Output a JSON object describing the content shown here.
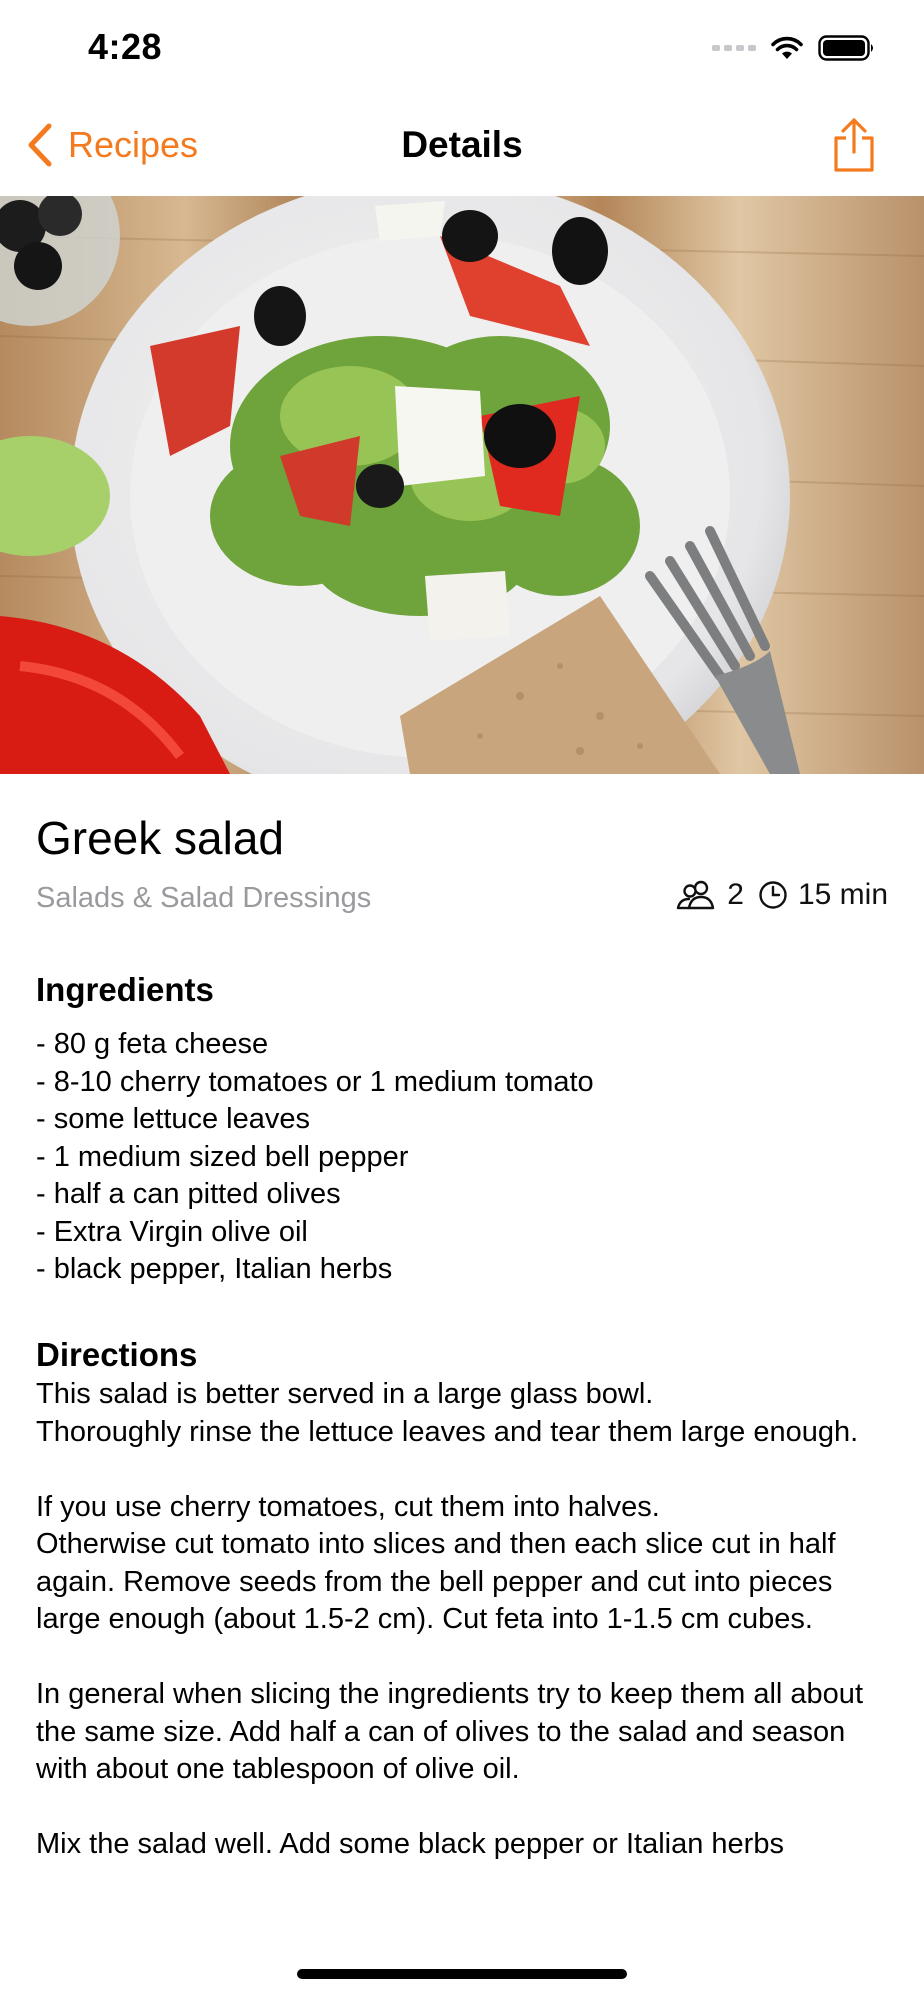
{
  "status_bar": {
    "time": "4:28"
  },
  "nav": {
    "back_label": "Recipes",
    "title": "Details",
    "accent_color": "#f47a1f"
  },
  "recipe": {
    "title": "Greek salad",
    "category": "Salads & Salad Dressings",
    "servings": "2",
    "time": "15 min",
    "ingredients_heading": "Ingredients",
    "ingredients": [
      "- 80 g feta cheese",
      "- 8-10 cherry tomatoes or 1 medium tomato",
      "- some lettuce leaves",
      "- 1 medium sized bell pepper",
      "- half a can pitted olives",
      "- Extra Virgin olive oil",
      "- black pepper, Italian herbs"
    ],
    "directions_heading": "Directions",
    "directions": [
      "This salad is better served in a large glass bowl.\nThoroughly rinse the lettuce leaves and tear them large enough.",
      "If you use cherry tomatoes, cut them into halves.\nOtherwise cut tomato into slices and then each slice cut in half again.  Remove seeds from the bell pepper and cut into pieces large enough (about 1.5-2 cm). Cut feta into 1-1.5 cm cubes.",
      "In general when slicing the ingredients try to keep them all about the same size. Add half a can of olives to the salad and season with about one tablespoon of olive oil.",
      "Mix the salad well. Add some black pepper or Italian herbs"
    ]
  },
  "icons": {
    "back": "chevron-left-icon",
    "share": "share-icon",
    "servings": "people-icon",
    "time": "clock-icon"
  }
}
